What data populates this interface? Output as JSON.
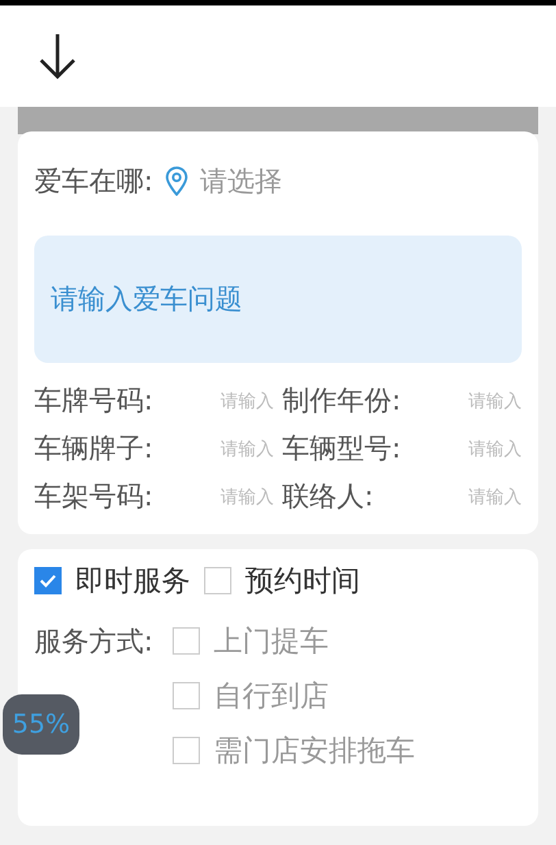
{
  "location": {
    "label": "爱车在哪:",
    "placeholder": "请选择"
  },
  "problem": {
    "placeholder": "请输入爱车问题"
  },
  "fields": [
    {
      "label": "车牌号码:",
      "placeholder": "请输入"
    },
    {
      "label": "制作年份:",
      "placeholder": "请输入"
    },
    {
      "label": "车辆牌子:",
      "placeholder": "请输入"
    },
    {
      "label": "车辆型号:",
      "placeholder": "请输入"
    },
    {
      "label": "车架号码:",
      "placeholder": "请输入"
    },
    {
      "label": "联络人:",
      "placeholder": "请输入"
    }
  ],
  "timing": [
    {
      "label": "即时服务",
      "checked": true
    },
    {
      "label": "预约时间",
      "checked": false
    }
  ],
  "service_method": {
    "label": "服务方式:",
    "options": [
      {
        "label": "上门提车",
        "checked": false
      },
      {
        "label": "自行到店",
        "checked": false
      },
      {
        "label": "需门店安排拖车",
        "checked": false
      }
    ]
  },
  "progress_badge": "55%"
}
